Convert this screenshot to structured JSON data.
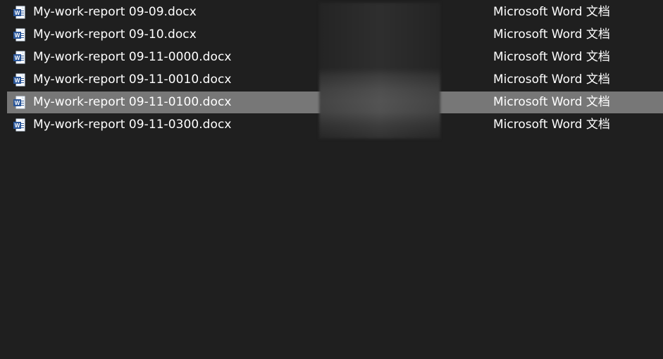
{
  "explorer": {
    "rows": [
      {
        "name": "My-work-report 09-09.docx",
        "type": "Microsoft Word 文档",
        "selected": false,
        "icon": "word-document-icon"
      },
      {
        "name": "My-work-report 09-10.docx",
        "type": "Microsoft Word 文档",
        "selected": false,
        "icon": "word-document-icon"
      },
      {
        "name": "My-work-report 09-11-0000.docx",
        "type": "Microsoft Word 文档",
        "selected": false,
        "icon": "word-document-icon"
      },
      {
        "name": "My-work-report 09-11-0010.docx",
        "type": "Microsoft Word 文档",
        "selected": false,
        "icon": "word-document-icon"
      },
      {
        "name": "My-work-report 09-11-0100.docx",
        "type": "Microsoft Word 文档",
        "selected": true,
        "icon": "word-document-icon"
      },
      {
        "name": "My-work-report 09-11-0300.docx",
        "type": "Microsoft Word 文档",
        "selected": false,
        "icon": "word-document-icon"
      }
    ],
    "colors": {
      "background": "#1f1f1f",
      "selected_row": "#777777",
      "text": "#ffffff",
      "word_blue": "#2b579a"
    }
  }
}
